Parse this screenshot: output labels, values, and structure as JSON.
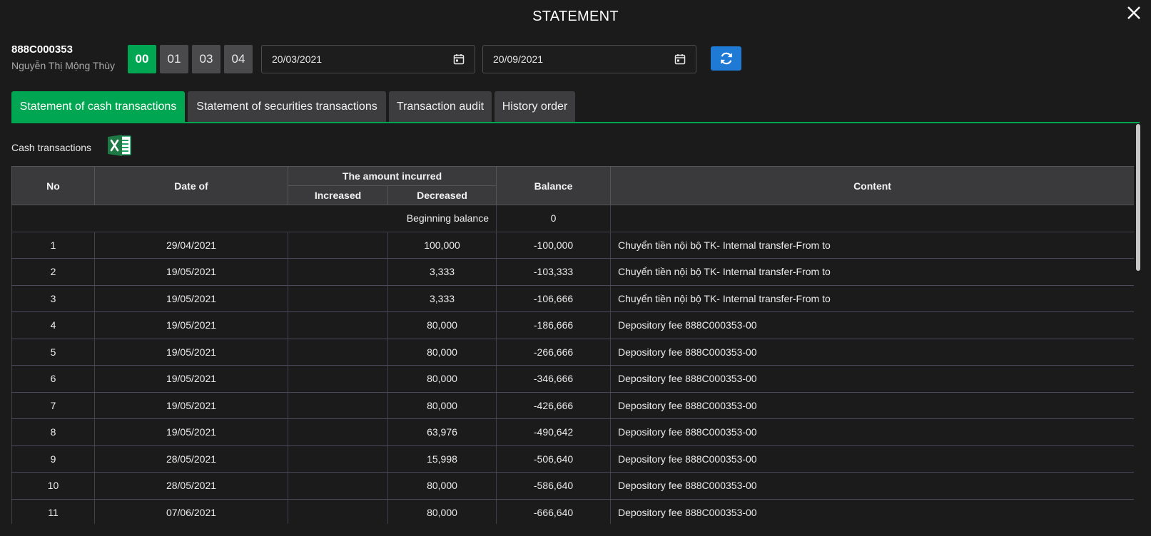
{
  "window": {
    "title": "STATEMENT"
  },
  "account": {
    "number": "888C000353",
    "name": "Nguyễn Thị Mộng Thùy"
  },
  "sub_accounts": [
    "00",
    "01",
    "03",
    "04"
  ],
  "active_sub_account": "00",
  "date_from": "20/03/2021",
  "date_to": "20/09/2021",
  "tabs": [
    "Statement of cash transactions",
    "Statement of securities transactions",
    "Transaction audit",
    "History order"
  ],
  "active_tab": "Statement of cash transactions",
  "section": {
    "label": "Cash transactions"
  },
  "table": {
    "headers": {
      "no": "No",
      "date": "Date of",
      "amount_group": "The amount incurred",
      "increased": "Increased",
      "decreased": "Decreased",
      "balance": "Balance",
      "content": "Content"
    },
    "beginning": {
      "label": "Beginning balance",
      "value": "0"
    },
    "rows": [
      {
        "no": "1",
        "date": "29/04/2021",
        "increased": "",
        "decreased": "100,000",
        "balance": "-100,000",
        "content": "Chuyển tiền nội bộ TK- Internal transfer-From to"
      },
      {
        "no": "2",
        "date": "19/05/2021",
        "increased": "",
        "decreased": "3,333",
        "balance": "-103,333",
        "content": "Chuyển tiền nội bộ TK- Internal transfer-From to"
      },
      {
        "no": "3",
        "date": "19/05/2021",
        "increased": "",
        "decreased": "3,333",
        "balance": "-106,666",
        "content": "Chuyển tiền nội bộ TK- Internal transfer-From to"
      },
      {
        "no": "4",
        "date": "19/05/2021",
        "increased": "",
        "decreased": "80,000",
        "balance": "-186,666",
        "content": "Depository fee 888C000353-00"
      },
      {
        "no": "5",
        "date": "19/05/2021",
        "increased": "",
        "decreased": "80,000",
        "balance": "-266,666",
        "content": "Depository fee 888C000353-00"
      },
      {
        "no": "6",
        "date": "19/05/2021",
        "increased": "",
        "decreased": "80,000",
        "balance": "-346,666",
        "content": "Depository fee 888C000353-00"
      },
      {
        "no": "7",
        "date": "19/05/2021",
        "increased": "",
        "decreased": "80,000",
        "balance": "-426,666",
        "content": "Depository fee 888C000353-00"
      },
      {
        "no": "8",
        "date": "19/05/2021",
        "increased": "",
        "decreased": "63,976",
        "balance": "-490,642",
        "content": "Depository fee 888C000353-00"
      },
      {
        "no": "9",
        "date": "28/05/2021",
        "increased": "",
        "decreased": "15,998",
        "balance": "-506,640",
        "content": "Depository fee 888C000353-00"
      },
      {
        "no": "10",
        "date": "28/05/2021",
        "increased": "",
        "decreased": "80,000",
        "balance": "-586,640",
        "content": "Depository fee 888C000353-00"
      },
      {
        "no": "11",
        "date": "07/06/2021",
        "increased": "",
        "decreased": "80,000",
        "balance": "-666,640",
        "content": "Depository fee 888C000353-00"
      }
    ]
  },
  "icons": {
    "close": "close-icon",
    "calendar": "calendar-icon",
    "refresh": "refresh-icon",
    "excel": "excel-icon"
  },
  "colors": {
    "accent_green": "#00a651",
    "button_blue": "#1f7ad6",
    "background": "#1b1b1c",
    "header_bg": "#3a3a3c"
  }
}
